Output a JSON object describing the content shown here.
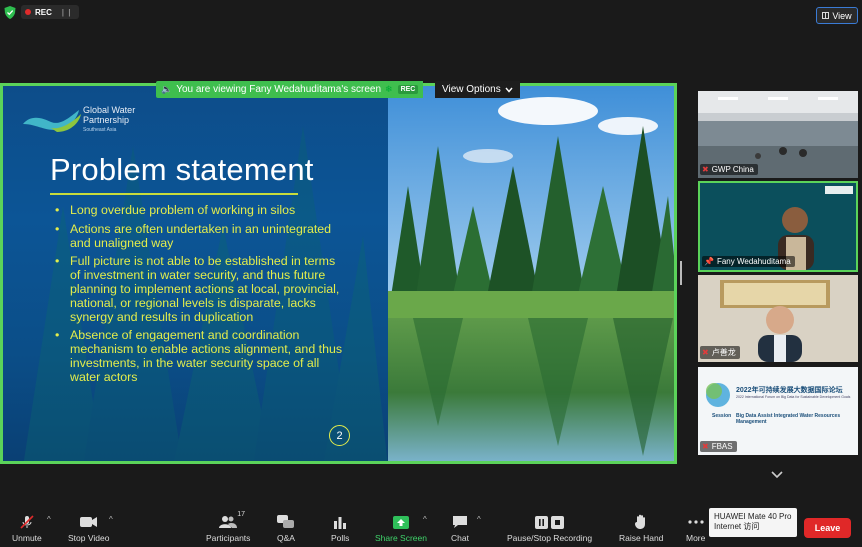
{
  "top_bar": {
    "rec_label": "REC",
    "pause_glyph": "| |",
    "view_label": "View"
  },
  "share": {
    "banner_text": "You are viewing Fany Wedahuditama's screen",
    "rec_tag": "REC",
    "view_options_label": "View Options"
  },
  "slide": {
    "logo_line1": "Global Water",
    "logo_line2": "Partnership",
    "logo_sub": "Southeast Asia",
    "title": "Problem statement",
    "bullets": [
      "Long overdue problem of working in silos",
      "Actions are often undertaken in an unintegrated and unaligned way",
      "Full picture is not able to be established in terms of investment in water security, and thus future planning to implement actions at local, provincial, national, or regional levels is disparate, lacks synergy and results in duplication",
      "Absence of engagement and coordination mechanism to enable actions alignment, and thus investments, in the water security space of all water actors"
    ],
    "page_number": "2"
  },
  "participants": [
    {
      "name": "GWP China",
      "muted": true
    },
    {
      "name": "Fany Wedahuditama",
      "muted": false
    },
    {
      "name": "卢善龙",
      "muted": true
    },
    {
      "name": "FBAS",
      "muted": true
    }
  ],
  "fbas_slide": {
    "title_cn": "2022年可持续发展大数据国际论坛",
    "title_en": "2022 International Forum on Big Data for Sustainable Development Goals",
    "session_label": "Session",
    "session_text": "Big Data Assist Integrated Water Resources Management"
  },
  "toolbar": {
    "unmute": "Unmute",
    "stop_video": "Stop Video",
    "participants": "Participants",
    "participants_count": "17",
    "qa": "Q&A",
    "polls": "Polls",
    "share_screen": "Share Screen",
    "chat": "Chat",
    "recording": "Pause/Stop Recording",
    "raise_hand": "Raise Hand",
    "more": "More",
    "leave": "Leave"
  },
  "tooltip": {
    "line1": "HUAWEI Mate 40 Pro",
    "line2": "Internet 访问"
  },
  "colors": {
    "accent_green": "#5bd35a",
    "leave_red": "#e02828",
    "slide_blue": "#0c5596",
    "bullet_yellow": "#e3ed4c"
  }
}
